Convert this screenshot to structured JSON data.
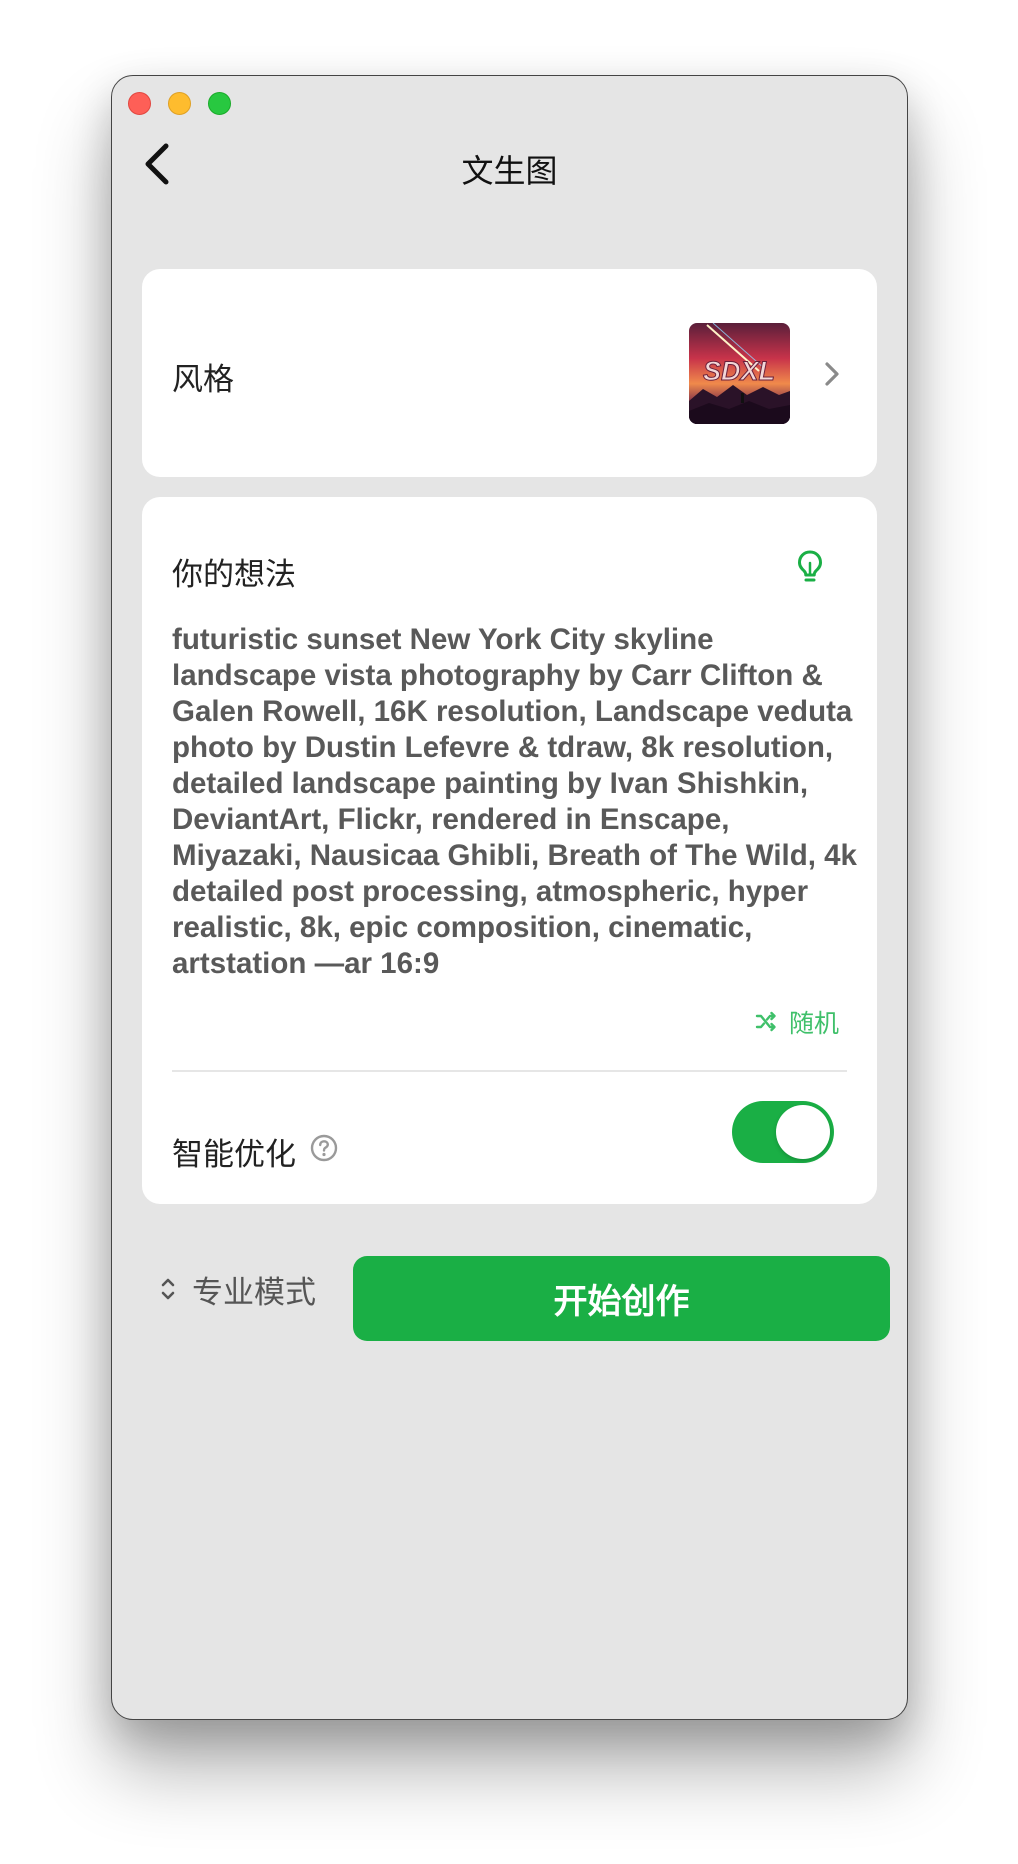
{
  "header": {
    "title": "文生图"
  },
  "style_card": {
    "label": "风格",
    "thumbnail_text": "SDXL"
  },
  "idea_card": {
    "label": "你的想法",
    "prompt": "futuristic sunset New York City skyline landscape vista photography by Carr Clifton & Galen Rowell, 16K resolution, Landscape veduta photo by Dustin Lefevre & tdraw, 8k resolution, detailed landscape painting by Ivan Shishkin, DeviantArt, Flickr, rendered in Enscape, Miyazaki, Nausicaa Ghibli, Breath of The Wild, 4k detailed post processing, atmospheric, hyper realistic, 8k, epic composition, cinematic, artstation —ar 16:9",
    "random_label": "随机",
    "smart_optimize_label": "智能优化",
    "smart_optimize_enabled": true
  },
  "footer": {
    "mode_label": "专业模式",
    "start_label": "开始创作"
  },
  "colors": {
    "accent": "#1aaf45",
    "accent_text": "#3fc06a",
    "background": "#e5e5e5",
    "card": "#ffffff"
  }
}
